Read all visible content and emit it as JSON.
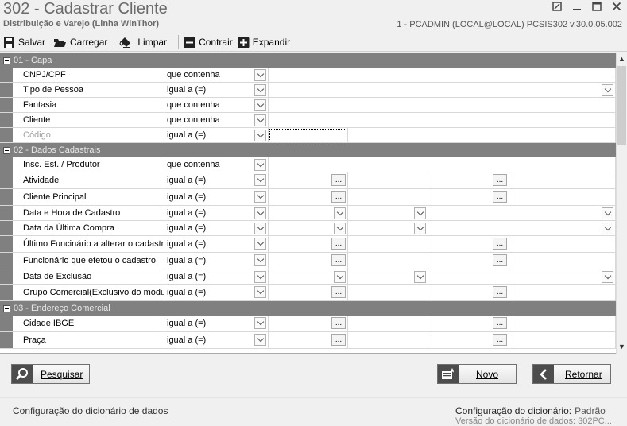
{
  "window": {
    "title": "302 - Cadastrar Cliente",
    "subtitle": "Distribuição e Varejo (Linha WinThor)",
    "info": "1 - PCADMIN (LOCAL@LOCAL)   PCSIS302  v.30.0.05.002"
  },
  "toolbar": {
    "save": "Salvar",
    "load": "Carregar",
    "clear": "Limpar",
    "collapse": "Contrair",
    "expand": "Expandir"
  },
  "sections": [
    {
      "title": "01 - Capa",
      "rows": [
        {
          "label": "CNPJ/CPF",
          "op": "que contenha"
        },
        {
          "label": "Tipo de Pessoa",
          "op": "igual a (=)"
        },
        {
          "label": "Fantasia",
          "op": "que contenha"
        },
        {
          "label": "Cliente",
          "op": "que contenha"
        },
        {
          "label": "Código",
          "op": "igual a (=)"
        }
      ]
    },
    {
      "title": "02 - Dados Cadastrais",
      "rows": [
        {
          "label": "Insc. Est. / Produtor",
          "op": "que contenha"
        },
        {
          "label": "Atividade",
          "op": "igual a (=)"
        },
        {
          "label": "Cliente Principal",
          "op": "igual a (=)"
        },
        {
          "label": "Data e Hora de Cadastro",
          "op": "igual a (=)"
        },
        {
          "label": "Data da Última Compra",
          "op": "igual a (=)"
        },
        {
          "label": "Último Funcinário a alterar o cadastro",
          "op": "igual a (=)"
        },
        {
          "label": "Funcionário que efetou o cadastro",
          "op": "igual a (=)"
        },
        {
          "label": "Data de Exclusão",
          "op": "igual a (=)"
        },
        {
          "label": "Grupo Comercial(Exclusivo do modulo",
          "op": "igual a (=)"
        }
      ]
    },
    {
      "title": "03 - Endereço Comercial",
      "rows": [
        {
          "label": "Cidade IBGE",
          "op": "igual a (=)"
        },
        {
          "label": "Praça",
          "op": "igual a (=)"
        }
      ]
    }
  ],
  "ellipsis": "...",
  "buttons": {
    "search": "Pesquisar",
    "new": "Novo",
    "back": "Retornar"
  },
  "status": {
    "left": "Configuração do dicionário de dados",
    "config_label": "Configuração do dicionário:",
    "config_value": "Padrão",
    "cut_line": "Versão do dicionário de dados: 302PC..."
  }
}
